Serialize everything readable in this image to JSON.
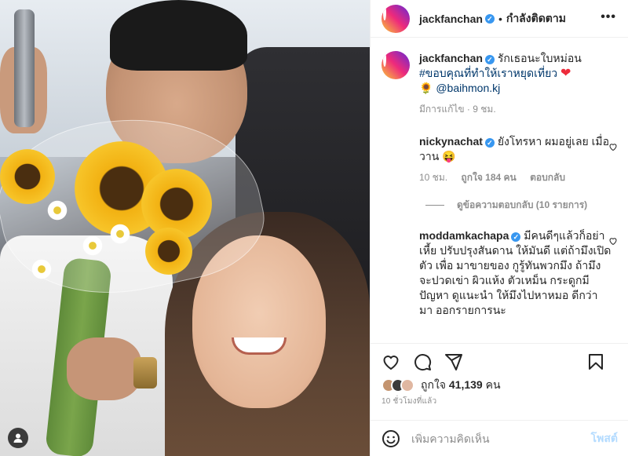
{
  "photo": {
    "user_tag_icon": "user-tag-icon"
  },
  "header": {
    "username": "jackfanchan",
    "verified_icon": "verified-badge-icon",
    "separator": "•",
    "follow_status": "กำลังติดตาม",
    "more_icon": "more-options-icon",
    "more_label": "•••"
  },
  "caption": {
    "username": "jackfanchan",
    "text_line1": "รักเธอนะใบหม่อน",
    "hashtag": "#ขอบคุณที่ทำให้เราหยุดเที่ยว",
    "heart_emoji": "❤",
    "sunflower_emoji": "🌻",
    "mention": "@baihmon.kj",
    "meta": "มีการแก้ไข · 9 ชม."
  },
  "comments": [
    {
      "username": "nickynachat",
      "text": "ยังโทรหา ผมอยู่เลย เมื่อวาน 😝",
      "time": "10 ชม.",
      "likes": "ถูกใจ 184 คน",
      "reply": "ตอบกลับ"
    },
    {
      "username": "moddamkachapa",
      "text": "มีคนดีๆแล้วก็อย่าเหี้ย ปรับปรุงสันดาน ให้มันดี แต่ถ้ามึงเปิดตัว เพื่อ มาขายของ กูรู้ทันพวกมึง ถ้ามึงจะปวดเข่า ผิวแห้ง ตัวเหม็น กระดูกมีปัญหา ดูแนะนำ ให้มึงไปหาหมอ ดีกว่า มา ออกรายการนะ"
    }
  ],
  "view_replies": "ดูข้อความตอบกลับ (10 รายการ)",
  "likes": {
    "prefix": "ถูกใจ",
    "count": "41,139",
    "suffix": "คน"
  },
  "timestamp": "10 ชั่วโมงที่แล้ว",
  "add_comment": {
    "placeholder": "เพิ่มความคิดเห็น",
    "post_label": "โพสต์"
  },
  "colors": {
    "verified": "#3897f0",
    "post_disabled": "#b3dbff",
    "link": "#00376b",
    "heart": "#ed2b3b"
  }
}
